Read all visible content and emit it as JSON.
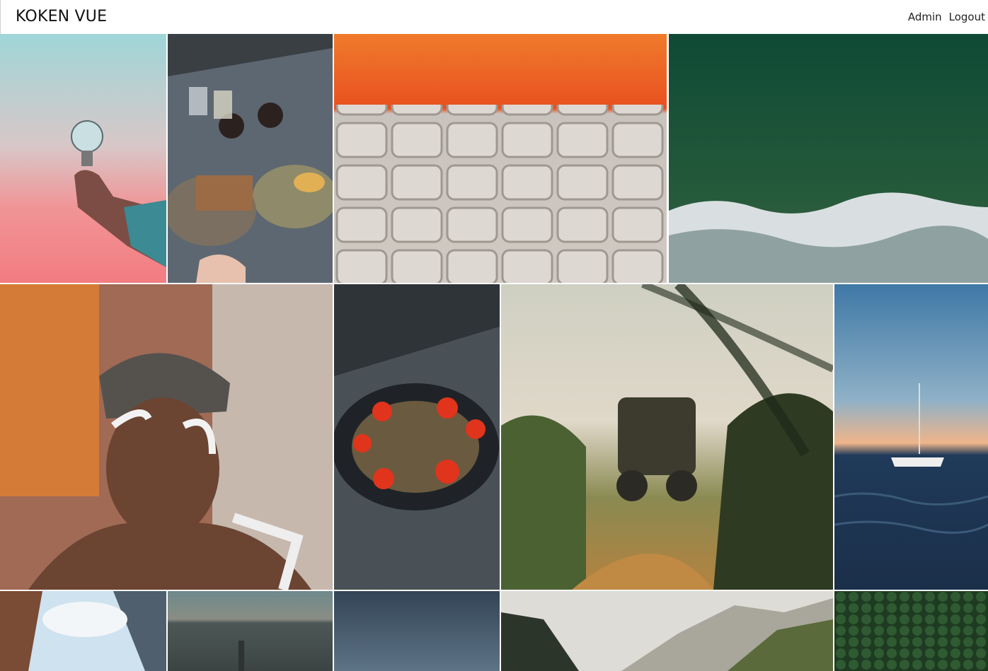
{
  "app": {
    "title": "KOKEN VUE"
  },
  "nav": {
    "admin_label": "Admin",
    "logout_label": "Logout"
  },
  "gallery": {
    "photos": [
      {
        "icon": "lightbulb-photo"
      },
      {
        "icon": "tea-table-photo"
      },
      {
        "icon": "stadium-seats-photo"
      },
      {
        "icon": "ocean-aerial-photo"
      },
      {
        "icon": "face-paint-portrait-photo"
      },
      {
        "icon": "food-plate-photo"
      },
      {
        "icon": "atv-jump-photo"
      },
      {
        "icon": "sailboat-sunset-photo"
      },
      {
        "icon": "building-sky-photo"
      },
      {
        "icon": "city-aerial-photo"
      },
      {
        "icon": "stormy-sky-photo"
      },
      {
        "icon": "mountain-valley-photo"
      },
      {
        "icon": "forest-aerial-photo"
      }
    ]
  }
}
